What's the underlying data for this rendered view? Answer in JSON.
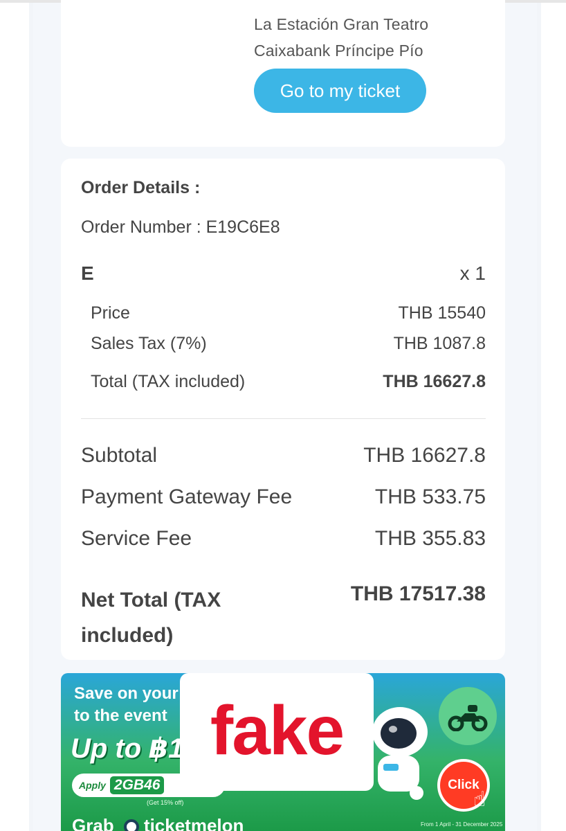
{
  "venue": {
    "line1": "La Estación Gran Teatro",
    "line2": "Caixabank Príncipe Pío",
    "button_label": "Go to my ticket"
  },
  "order": {
    "heading": "Order Details :",
    "number_label": "Order Number : E19C6E8",
    "ticket": {
      "name": "E",
      "qty": "x 1",
      "lines": [
        {
          "label": "Price",
          "value": "THB 15540"
        },
        {
          "label": "Sales Tax (7%)",
          "value": "THB 1087.8"
        },
        {
          "label": "Total (TAX included)",
          "value": "THB 16627.8"
        }
      ]
    },
    "summary": [
      {
        "label": "Subtotal",
        "value": "THB 16627.8"
      },
      {
        "label": "Payment Gateway Fee",
        "value": "THB 533.75"
      },
      {
        "label": "Service Fee",
        "value": "THB 355.83"
      }
    ],
    "net_total": {
      "label": "Net Total (TAX included)",
      "value": "THB 17517.38"
    }
  },
  "banner": {
    "line1": "Save on your",
    "line2": "to the event",
    "headline": "Up to ฿1",
    "apply_label": "Apply",
    "code": "2GB46",
    "get_note": "(Get 15% off)",
    "click_label": "Click",
    "brand1": "Grab",
    "brand2": "ticketmelon",
    "dates": "From 1 April - 31 December 2025"
  },
  "overlay": {
    "stamp": "fake"
  },
  "colors": {
    "accent": "#3cb6e6",
    "stamp": "#e3142c",
    "banner_green": "#34b36a"
  }
}
